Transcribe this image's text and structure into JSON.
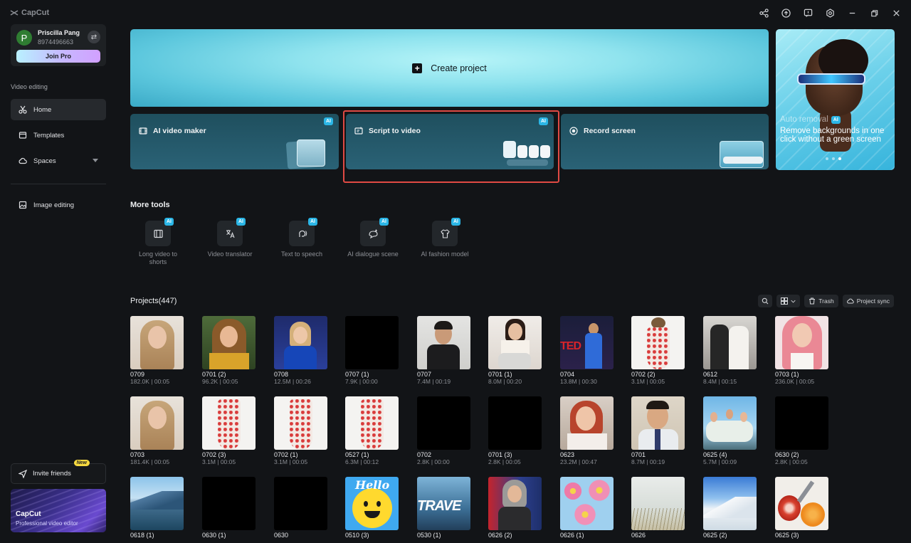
{
  "app": {
    "name": "CapCut"
  },
  "profile": {
    "name": "Priscilla Pang",
    "id": "8974496663",
    "initial": "P",
    "join_pro": "Join Pro"
  },
  "sidebar": {
    "section_label": "Video editing",
    "items": [
      {
        "label": "Home"
      },
      {
        "label": "Templates"
      },
      {
        "label": "Spaces"
      },
      {
        "label": "Image editing"
      }
    ],
    "invite": {
      "label": "Invite friends",
      "badge": "New"
    },
    "promo": {
      "title": "CapCut",
      "subtitle": "Professional video editor"
    }
  },
  "create": {
    "label": "Create project"
  },
  "tool_cards": [
    {
      "label": "AI video maker",
      "badge": "AI"
    },
    {
      "label": "Script to video",
      "badge": "AI"
    },
    {
      "label": "Record screen"
    }
  ],
  "auto_card": {
    "title": "Auto removal",
    "badge": "AI",
    "description": "Remove backgrounds in one click without a green screen"
  },
  "more_tools": {
    "title": "More tools",
    "items": [
      {
        "label": "Long video to shorts",
        "badge": "AI"
      },
      {
        "label": "Video translator",
        "badge": "AI"
      },
      {
        "label": "Text to speech",
        "badge": "AI"
      },
      {
        "label": "AI dialogue scene",
        "badge": "AI"
      },
      {
        "label": "AI fashion model",
        "badge": "AI"
      }
    ]
  },
  "projects": {
    "title": "Projects(447)",
    "trash_label": "Trash",
    "sync_label": "Project sync",
    "items": [
      {
        "name": "0709",
        "meta": "182.0K | 00:05"
      },
      {
        "name": "0701 (2)",
        "meta": "96.2K | 00:05"
      },
      {
        "name": "0708",
        "meta": "12.5M | 00:26"
      },
      {
        "name": "0707 (1)",
        "meta": "7.9K | 00:00"
      },
      {
        "name": "0707",
        "meta": "7.4M | 00:19"
      },
      {
        "name": "0701 (1)",
        "meta": "8.0M | 00:20"
      },
      {
        "name": "0704",
        "meta": "13.8M | 00:30"
      },
      {
        "name": "0702 (2)",
        "meta": "3.1M | 00:05"
      },
      {
        "name": "0612",
        "meta": "8.4M | 00:15"
      },
      {
        "name": "0703 (1)",
        "meta": "236.0K | 00:05"
      },
      {
        "name": "0703",
        "meta": "181.4K | 00:05"
      },
      {
        "name": "0702 (3)",
        "meta": "3.1M | 00:05"
      },
      {
        "name": "0702 (1)",
        "meta": "3.1M | 00:05"
      },
      {
        "name": "0527 (1)",
        "meta": "6.3M | 00:12"
      },
      {
        "name": "0702",
        "meta": "2.8K | 00:00"
      },
      {
        "name": "0701 (3)",
        "meta": "2.8K | 00:05"
      },
      {
        "name": "0623",
        "meta": "23.2M | 00:47"
      },
      {
        "name": "0701",
        "meta": "8.7M | 00:19"
      },
      {
        "name": "0625 (4)",
        "meta": "5.7M | 00:09"
      },
      {
        "name": "0630 (2)",
        "meta": "2.8K | 00:05"
      },
      {
        "name": "0618 (1)",
        "meta": ""
      },
      {
        "name": "0630 (1)",
        "meta": ""
      },
      {
        "name": "0630",
        "meta": ""
      },
      {
        "name": "0510 (3)",
        "meta": ""
      },
      {
        "name": "0530 (1)",
        "meta": ""
      },
      {
        "name": "0626 (2)",
        "meta": ""
      },
      {
        "name": "0626 (1)",
        "meta": ""
      },
      {
        "name": "0626",
        "meta": ""
      },
      {
        "name": "0625 (2)",
        "meta": ""
      },
      {
        "name": "0625 (3)",
        "meta": ""
      }
    ],
    "thumb_overlays": {
      "hello": "Hello",
      "travel": "TRAVE",
      "ted": "TED"
    }
  }
}
